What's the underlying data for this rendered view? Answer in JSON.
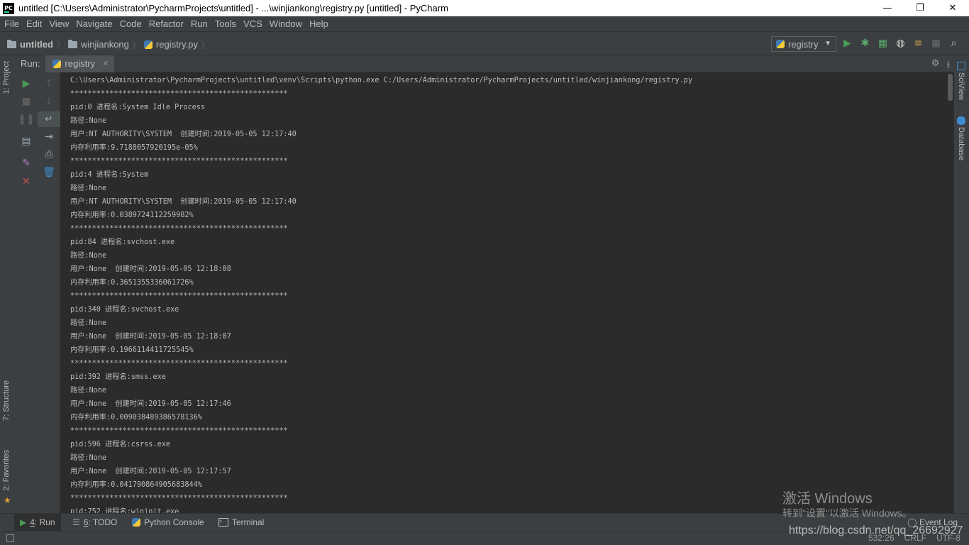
{
  "window": {
    "title": "untitled [C:\\Users\\Administrator\\PycharmProjects\\untitled] - ...\\winjiankong\\registry.py [untitled] - PyCharm",
    "logo_text": "PC",
    "minimize": "—",
    "restore": "❐",
    "close": "✕"
  },
  "menu": [
    "File",
    "Edit",
    "View",
    "Navigate",
    "Code",
    "Refactor",
    "Run",
    "Tools",
    "VCS",
    "Window",
    "Help"
  ],
  "breadcrumb": {
    "project": "untitled",
    "folder": "winjiankong",
    "file": "registry.py"
  },
  "run_config": {
    "name": "registry"
  },
  "run_panel": {
    "label": "Run:",
    "tab": "registry"
  },
  "left_tabs": {
    "project": "1: Project",
    "structure": "7: Structure",
    "favorites": "2: Favorites"
  },
  "right_tabs": {
    "sciview": "SciView",
    "database": "Database"
  },
  "console_lines": [
    "C:\\Users\\Administrator\\PycharmProjects\\untitled\\venv\\Scripts\\python.exe C:/Users/Administrator/PycharmProjects/untitled/winjiankong/registry.py",
    "**************************************************",
    "pid:0 进程名:System Idle Process",
    "路径:None",
    "用户:NT AUTHORITY\\SYSTEM  创建时间:2019-05-05 12:17:40",
    "内存利用率:9.7188057920195e-05%",
    "**************************************************",
    "pid:4 进程名:System",
    "路径:None",
    "用户:NT AUTHORITY\\SYSTEM  创建时间:2019-05-05 12:17:40",
    "内存利用率:0.0389724112259982%",
    "**************************************************",
    "pid:84 进程名:svchost.exe",
    "路径:None",
    "用户:None  创建时间:2019-05-05 12:18:08",
    "内存利用率:0.3651355336061726%",
    "**************************************************",
    "pid:340 进程名:svchost.exe",
    "路径:None",
    "用户:None  创建时间:2019-05-05 12:18:07",
    "内存利用率:0.1966114411725545%",
    "**************************************************",
    "pid:392 进程名:smss.exe",
    "路径:None",
    "用户:None  创建时间:2019-05-05 12:17:46",
    "内存利用率:0.009038489386578136%",
    "**************************************************",
    "pid:596 进程名:csrss.exe",
    "路径:None",
    "用户:None  创建时间:2019-05-05 12:17:57",
    "内存利用率:0.041790864905683844%",
    "**************************************************",
    "pid:752 进程名:wininit.exe"
  ],
  "bottom_tabs": {
    "run_num": "4",
    "run": ": Run",
    "todo_num": "6",
    "todo": ": TODO",
    "python_console": "Python Console",
    "terminal": "Terminal"
  },
  "status": {
    "event_log": "Event Log",
    "position": "532:26",
    "line_sep": "CRLF",
    "encoding": "UTF-8"
  },
  "watermark": {
    "line1": "激活 Windows",
    "line2": "转到\"设置\"以激活 Windows。",
    "csdn": "https://blog.csdn.net/qq_26692927"
  },
  "colors": {
    "run_green": "#499c54",
    "debug_green": "#59a869",
    "stop_red": "#c75450",
    "accent_blue": "#3d7ab3"
  }
}
